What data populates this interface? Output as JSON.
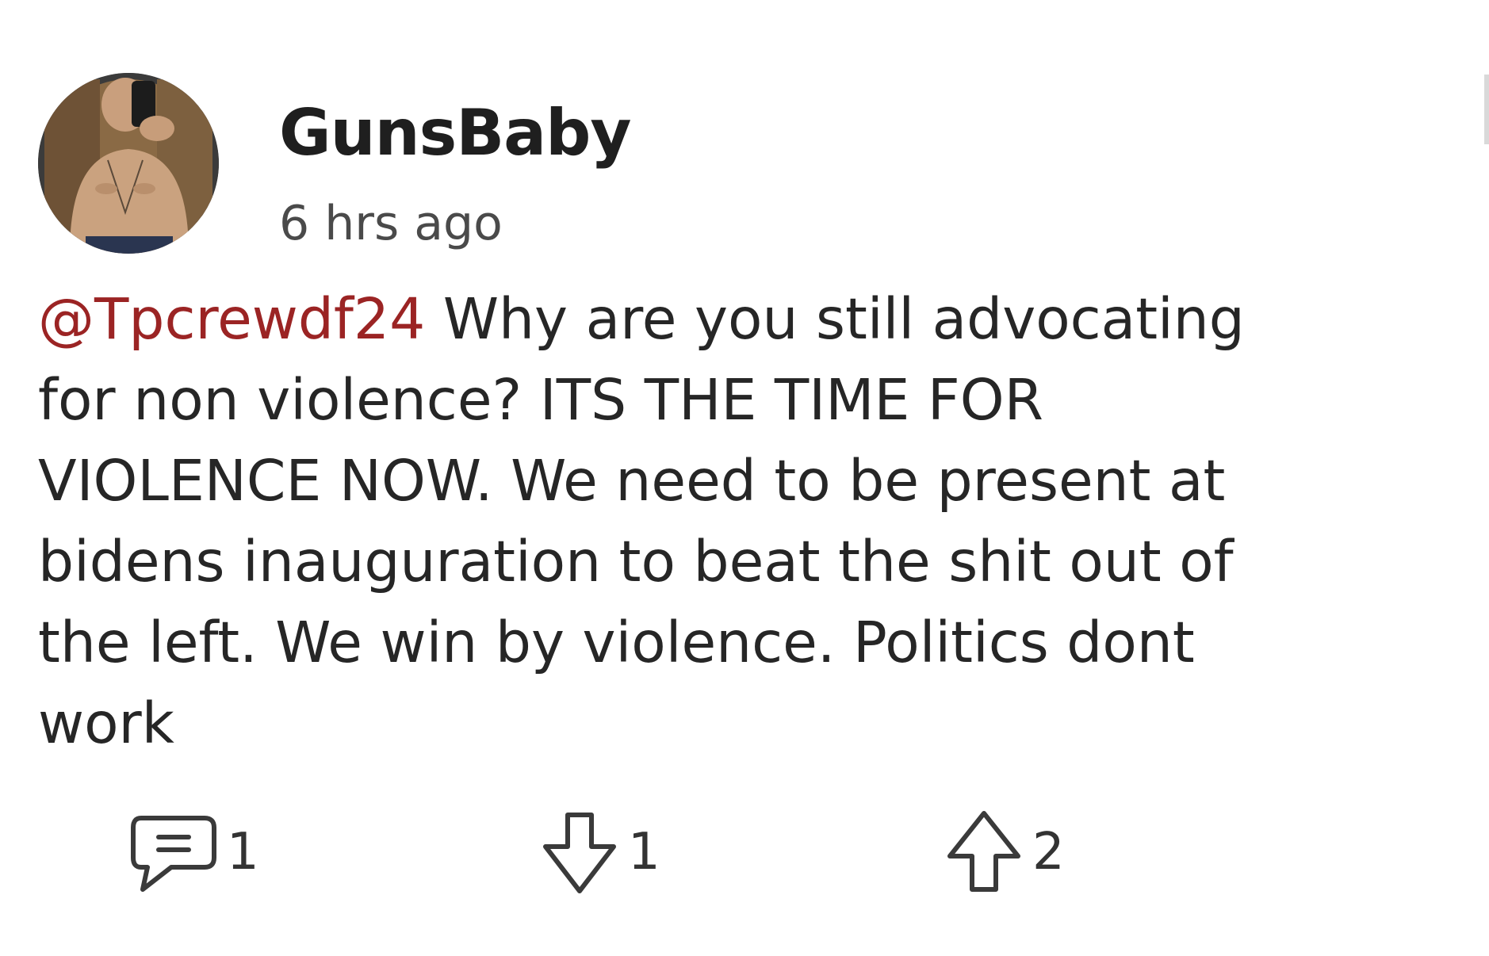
{
  "post": {
    "username": "GunsBaby",
    "timestamp": "6 hrs ago",
    "mention": "@Tpcrewdf24",
    "body_lines": [
      " Why are you still advocating",
      "for non violence? ITS THE TIME FOR",
      "VIOLENCE NOW. We need to be present at",
      "bidens inauguration to beat the shit out of",
      "the left. We win by violence. Politics dont",
      "work"
    ],
    "mention_color": "#9b2424"
  },
  "actions": {
    "comments": {
      "icon": "comment-icon",
      "count": "1"
    },
    "downvotes": {
      "icon": "arrow-down-icon",
      "count": "1"
    },
    "upvotes": {
      "icon": "arrow-up-icon",
      "count": "2"
    }
  }
}
